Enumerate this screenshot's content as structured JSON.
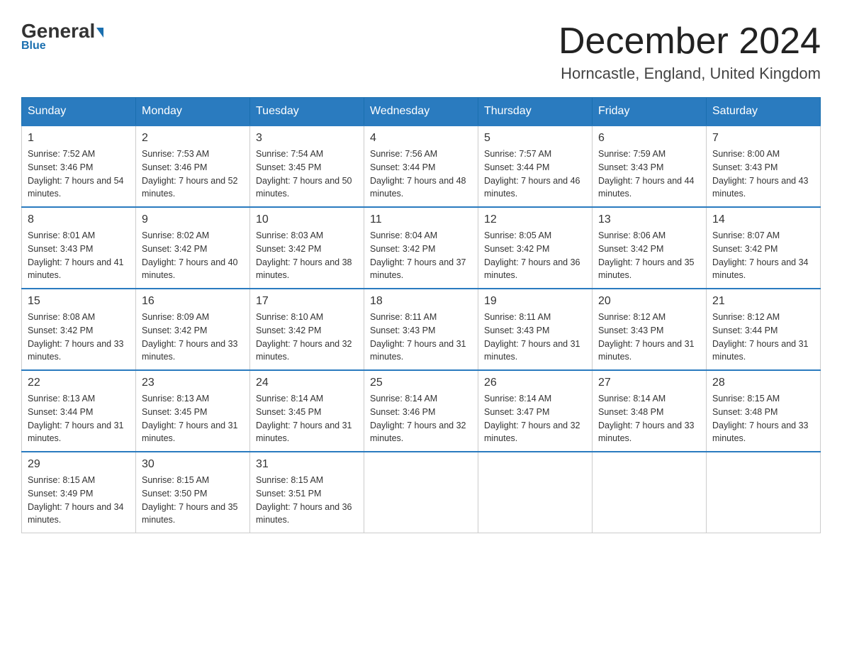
{
  "header": {
    "logo_general": "General",
    "logo_blue": "Blue",
    "month_year": "December 2024",
    "location": "Horncastle, England, United Kingdom"
  },
  "days_of_week": [
    "Sunday",
    "Monday",
    "Tuesday",
    "Wednesday",
    "Thursday",
    "Friday",
    "Saturday"
  ],
  "weeks": [
    [
      {
        "day": "1",
        "sunrise": "7:52 AM",
        "sunset": "3:46 PM",
        "daylight": "7 hours and 54 minutes."
      },
      {
        "day": "2",
        "sunrise": "7:53 AM",
        "sunset": "3:46 PM",
        "daylight": "7 hours and 52 minutes."
      },
      {
        "day": "3",
        "sunrise": "7:54 AM",
        "sunset": "3:45 PM",
        "daylight": "7 hours and 50 minutes."
      },
      {
        "day": "4",
        "sunrise": "7:56 AM",
        "sunset": "3:44 PM",
        "daylight": "7 hours and 48 minutes."
      },
      {
        "day": "5",
        "sunrise": "7:57 AM",
        "sunset": "3:44 PM",
        "daylight": "7 hours and 46 minutes."
      },
      {
        "day": "6",
        "sunrise": "7:59 AM",
        "sunset": "3:43 PM",
        "daylight": "7 hours and 44 minutes."
      },
      {
        "day": "7",
        "sunrise": "8:00 AM",
        "sunset": "3:43 PM",
        "daylight": "7 hours and 43 minutes."
      }
    ],
    [
      {
        "day": "8",
        "sunrise": "8:01 AM",
        "sunset": "3:43 PM",
        "daylight": "7 hours and 41 minutes."
      },
      {
        "day": "9",
        "sunrise": "8:02 AM",
        "sunset": "3:42 PM",
        "daylight": "7 hours and 40 minutes."
      },
      {
        "day": "10",
        "sunrise": "8:03 AM",
        "sunset": "3:42 PM",
        "daylight": "7 hours and 38 minutes."
      },
      {
        "day": "11",
        "sunrise": "8:04 AM",
        "sunset": "3:42 PM",
        "daylight": "7 hours and 37 minutes."
      },
      {
        "day": "12",
        "sunrise": "8:05 AM",
        "sunset": "3:42 PM",
        "daylight": "7 hours and 36 minutes."
      },
      {
        "day": "13",
        "sunrise": "8:06 AM",
        "sunset": "3:42 PM",
        "daylight": "7 hours and 35 minutes."
      },
      {
        "day": "14",
        "sunrise": "8:07 AM",
        "sunset": "3:42 PM",
        "daylight": "7 hours and 34 minutes."
      }
    ],
    [
      {
        "day": "15",
        "sunrise": "8:08 AM",
        "sunset": "3:42 PM",
        "daylight": "7 hours and 33 minutes."
      },
      {
        "day": "16",
        "sunrise": "8:09 AM",
        "sunset": "3:42 PM",
        "daylight": "7 hours and 33 minutes."
      },
      {
        "day": "17",
        "sunrise": "8:10 AM",
        "sunset": "3:42 PM",
        "daylight": "7 hours and 32 minutes."
      },
      {
        "day": "18",
        "sunrise": "8:11 AM",
        "sunset": "3:43 PM",
        "daylight": "7 hours and 31 minutes."
      },
      {
        "day": "19",
        "sunrise": "8:11 AM",
        "sunset": "3:43 PM",
        "daylight": "7 hours and 31 minutes."
      },
      {
        "day": "20",
        "sunrise": "8:12 AM",
        "sunset": "3:43 PM",
        "daylight": "7 hours and 31 minutes."
      },
      {
        "day": "21",
        "sunrise": "8:12 AM",
        "sunset": "3:44 PM",
        "daylight": "7 hours and 31 minutes."
      }
    ],
    [
      {
        "day": "22",
        "sunrise": "8:13 AM",
        "sunset": "3:44 PM",
        "daylight": "7 hours and 31 minutes."
      },
      {
        "day": "23",
        "sunrise": "8:13 AM",
        "sunset": "3:45 PM",
        "daylight": "7 hours and 31 minutes."
      },
      {
        "day": "24",
        "sunrise": "8:14 AM",
        "sunset": "3:45 PM",
        "daylight": "7 hours and 31 minutes."
      },
      {
        "day": "25",
        "sunrise": "8:14 AM",
        "sunset": "3:46 PM",
        "daylight": "7 hours and 32 minutes."
      },
      {
        "day": "26",
        "sunrise": "8:14 AM",
        "sunset": "3:47 PM",
        "daylight": "7 hours and 32 minutes."
      },
      {
        "day": "27",
        "sunrise": "8:14 AM",
        "sunset": "3:48 PM",
        "daylight": "7 hours and 33 minutes."
      },
      {
        "day": "28",
        "sunrise": "8:15 AM",
        "sunset": "3:48 PM",
        "daylight": "7 hours and 33 minutes."
      }
    ],
    [
      {
        "day": "29",
        "sunrise": "8:15 AM",
        "sunset": "3:49 PM",
        "daylight": "7 hours and 34 minutes."
      },
      {
        "day": "30",
        "sunrise": "8:15 AM",
        "sunset": "3:50 PM",
        "daylight": "7 hours and 35 minutes."
      },
      {
        "day": "31",
        "sunrise": "8:15 AM",
        "sunset": "3:51 PM",
        "daylight": "7 hours and 36 minutes."
      },
      null,
      null,
      null,
      null
    ]
  ]
}
